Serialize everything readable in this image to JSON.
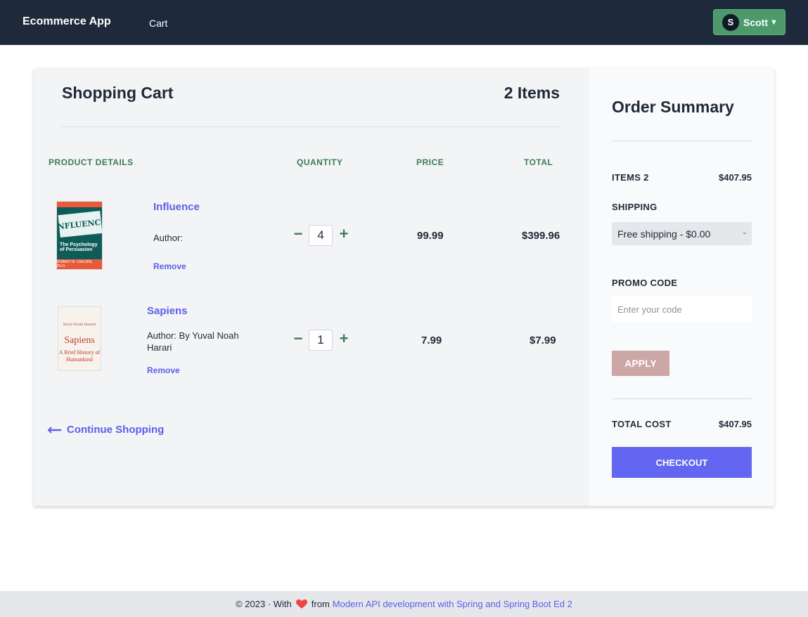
{
  "nav": {
    "brand": "Ecommerce App",
    "cart_link": "Cart",
    "user_initial": "S",
    "user_name": "Scott",
    "user_caret": "▼"
  },
  "cart": {
    "title": "Shopping Cart",
    "count_label": "2 Items",
    "columns": {
      "product": "PRODUCT DETAILS",
      "quantity": "QUANTITY",
      "price": "PRICE",
      "total": "TOTAL"
    },
    "items": [
      {
        "name": "Influence",
        "author": "Author:",
        "remove": "Remove",
        "quantity": "4",
        "price": "99.99",
        "total": "$399.96",
        "cover_title": "INFLUENCE",
        "cover_subtitle": "The Psychology of Persuasion",
        "cover_author": "ROBERT B. CIALDINI, Ph.D."
      },
      {
        "name": "Sapiens",
        "author": "Author: By Yuval Noah Harari",
        "remove": "Remove",
        "quantity": "1",
        "price": "7.99",
        "total": "$7.99",
        "cover_author": "Yuval Noah Harari",
        "cover_title": "Sapiens",
        "cover_subtitle": "A Brief History of Humankind"
      }
    ],
    "qty_minus": "−",
    "qty_plus": "+",
    "continue_label": "Continue Shopping"
  },
  "summary": {
    "title": "Order Summary",
    "items_label": "ITEMS 2",
    "items_value": "$407.95",
    "shipping_label": "SHIPPING",
    "shipping_selected": "Free shipping - $0.00",
    "promo_label": "PROMO CODE",
    "promo_placeholder": "Enter your code",
    "apply_label": "APPLY",
    "total_label": "TOTAL COST",
    "total_value": "$407.95",
    "checkout_label": "CHECKOUT"
  },
  "footer": {
    "prefix": "© 2023 · With",
    "middle": "from",
    "link": "Modern API development with Spring and Spring Boot Ed 2"
  },
  "colors": {
    "navbar": "#1e293b",
    "accent": "#6366f1",
    "user_button": "#4c9a6a",
    "column_header": "#3d7c57",
    "heart": "#ef4444"
  }
}
